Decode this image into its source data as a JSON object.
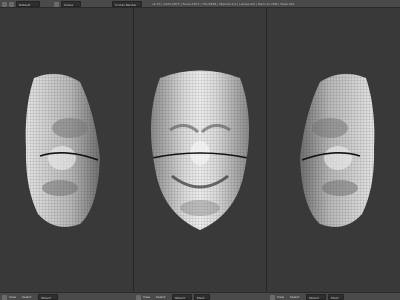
{
  "top_bar": {
    "editor_icon": "info-editor-icon",
    "layout_icon": "screen-layout-icon",
    "layout": "Default",
    "scene_icon": "scene-icon",
    "scene": "Scene",
    "render_engine": "Cycles Render",
    "info_text": "v2.70 | Verts:2873 | Faces:2871 | Tris:5698 | Objects:1/1 | Lamps:0/0 | Mem:41.20M | Mask.001"
  },
  "viewport": {
    "panes": [
      {
        "name": "left-view",
        "object_icon": "face-mask-mesh-icon"
      },
      {
        "name": "front-view",
        "object_icon": "face-mask-mesh-icon"
      },
      {
        "name": "right-view",
        "object_icon": "face-mask-mesh-icon"
      }
    ]
  },
  "bottom_bar": {
    "left_view": {
      "mode": "Object",
      "view": "View",
      "select": "Select"
    },
    "front_view": {
      "mode": "Object",
      "view": "View",
      "select": "Select",
      "pivot": "Pivot"
    },
    "right_view": {
      "mode": "Object",
      "view": "View",
      "select": "Select",
      "pivot": "Pivot"
    }
  },
  "colors": {
    "header": "#4a4a4a",
    "viewport": "#393939",
    "mesh_light": "#e6e6e6",
    "mesh_shade": "#8f8f8f",
    "wire": "#202020"
  }
}
